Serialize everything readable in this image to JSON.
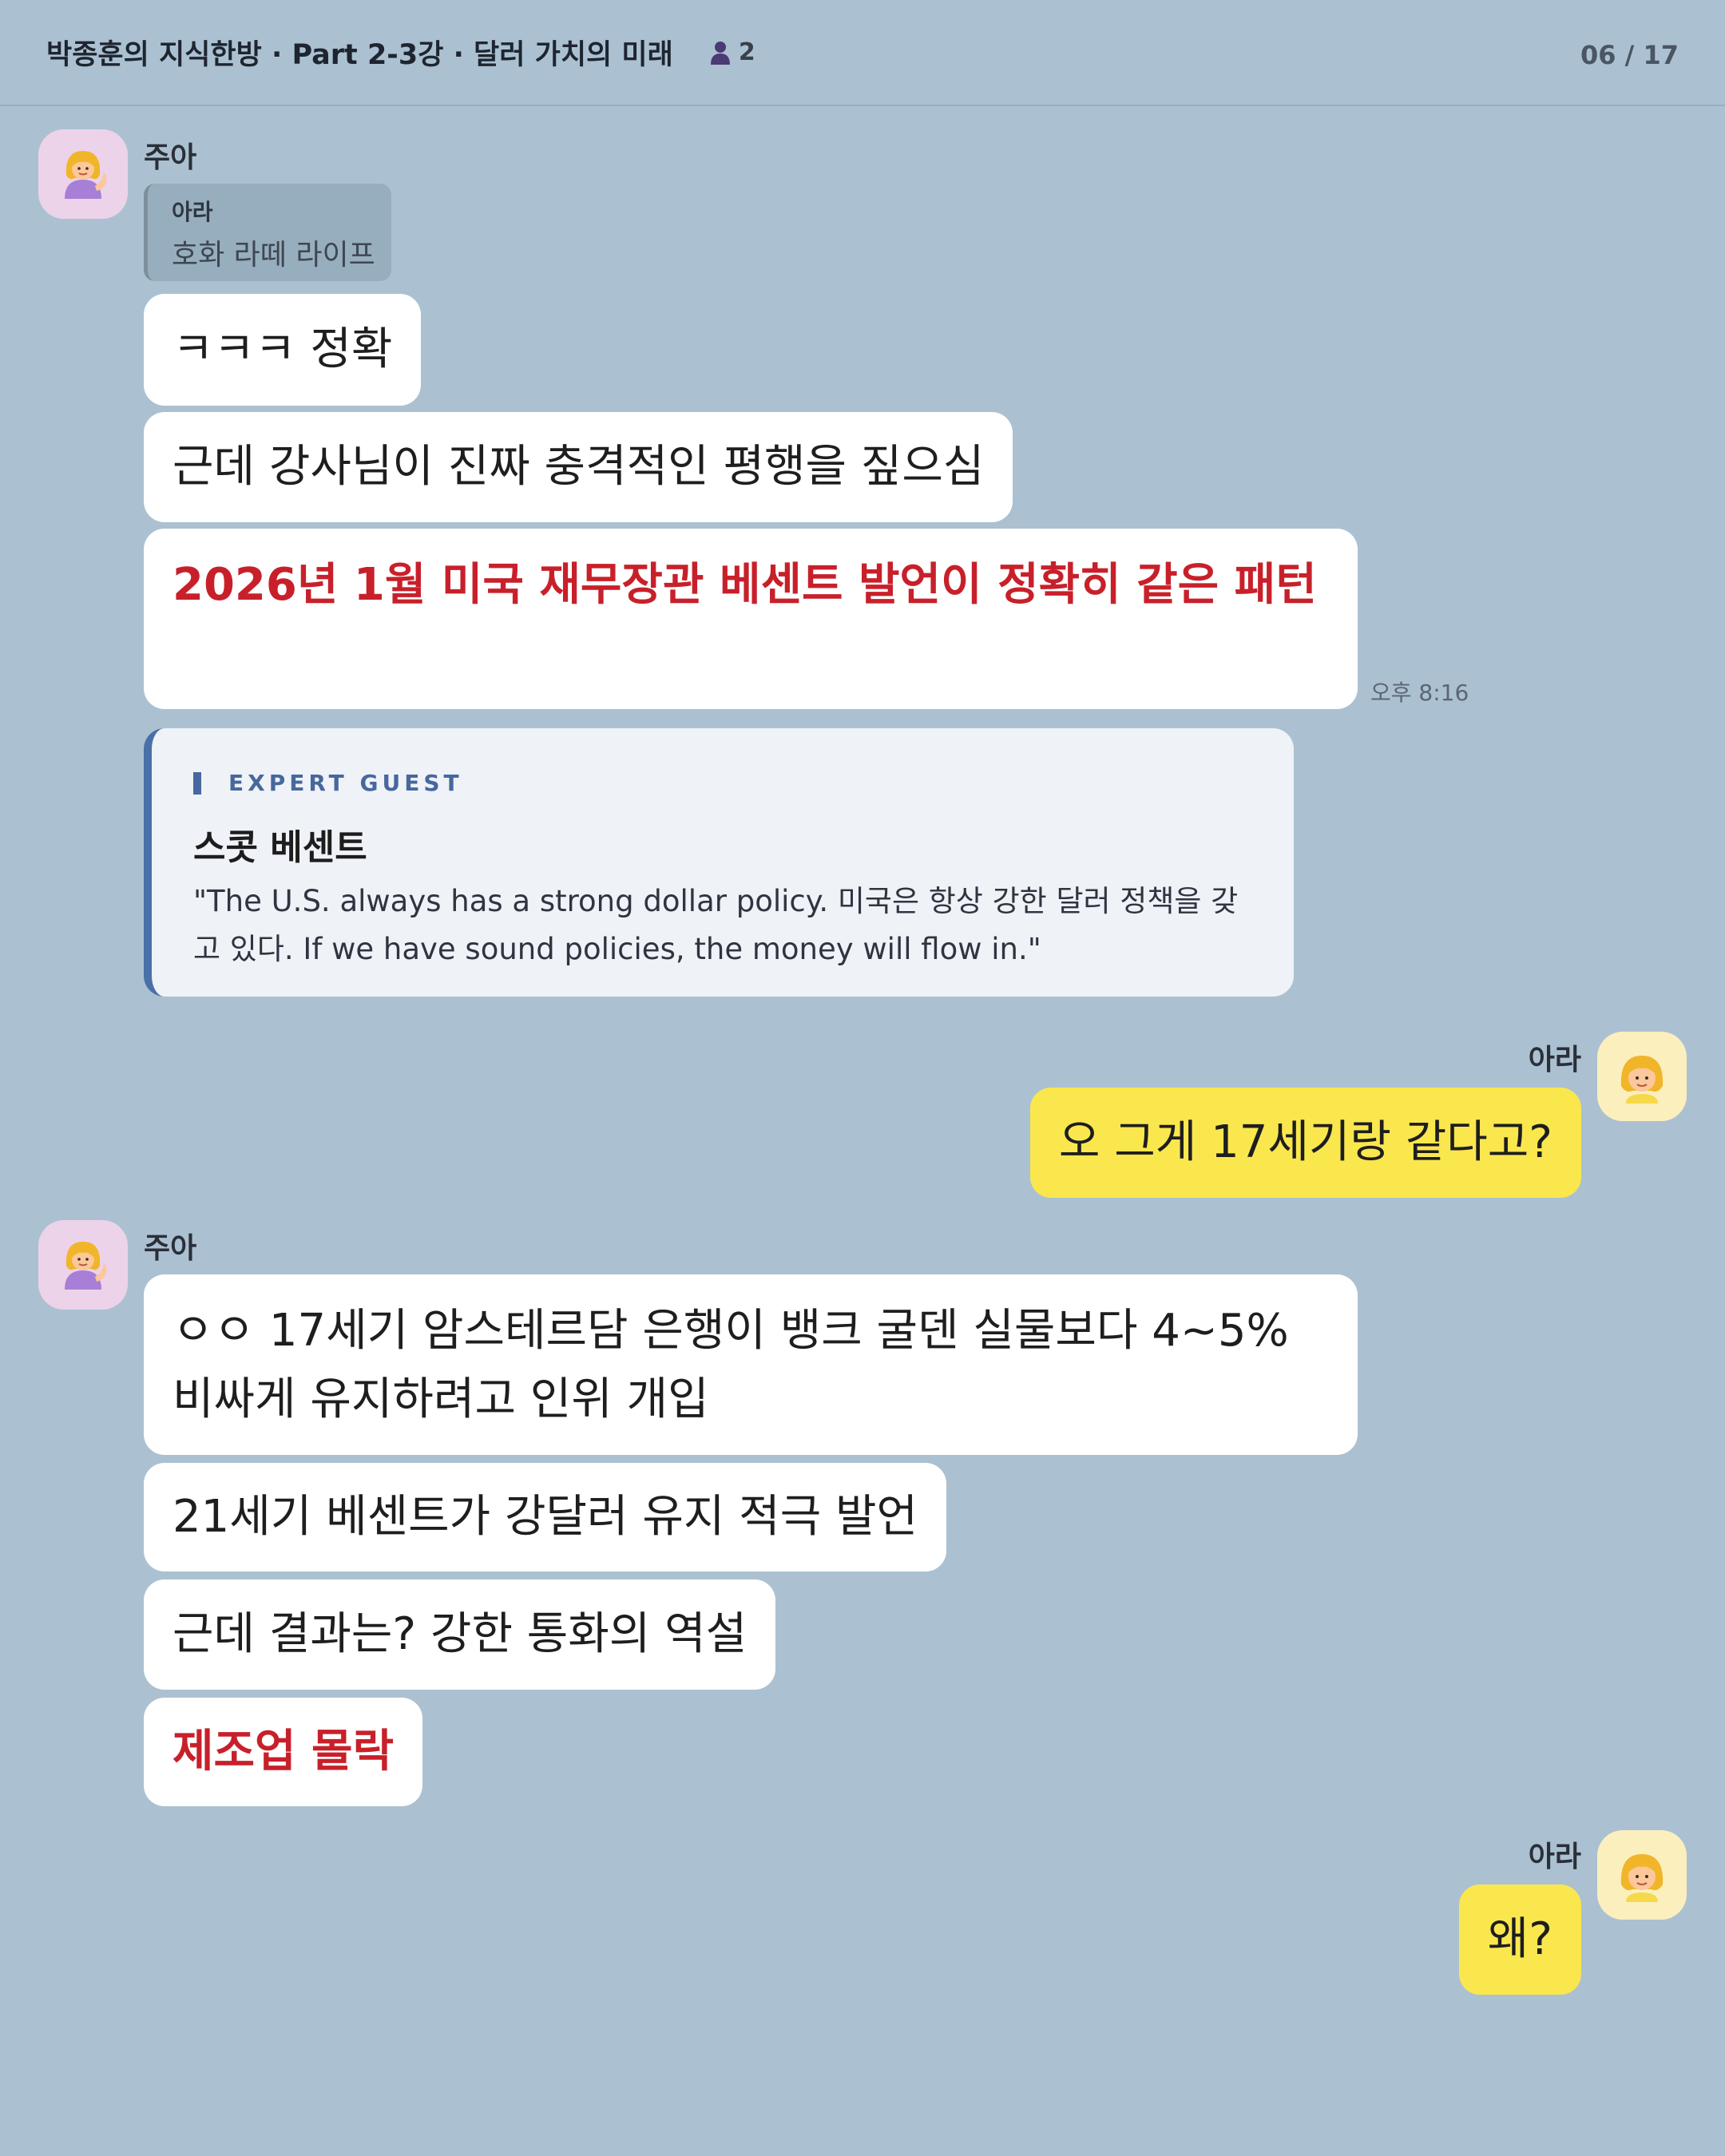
{
  "header": {
    "title": "박종훈의 지식한방 · Part 2-3강 · 달러 가치의 미래",
    "member_count": "2",
    "page_counter": "06 / 17"
  },
  "messages": {
    "m1": {
      "sender": "주아",
      "reply": {
        "name": "아라",
        "text": "호화 라떼 라이프"
      },
      "b1": "ㅋㅋㅋ 정확",
      "b2": "근데 강사님이 진짜 충격적인 평행을 짚으심",
      "b3": "2026년 1월 미국 재무장관 베센트 발언이 정확히 같은 패턴",
      "time": "오후 8:16"
    },
    "expert": {
      "tag": "EXPERT GUEST",
      "name": "스콧 베센트",
      "quote": "\"The U.S. always has a strong dollar policy. 미국은 항상 강한 달러 정책을 갖고 있다. If we have sound policies, the money will flow in.\""
    },
    "m2": {
      "sender": "아라",
      "b1": "오 그게 17세기랑 같다고?"
    },
    "m3": {
      "sender": "주아",
      "b1": "ㅇㅇ 17세기 암스테르담 은행이 뱅크 굴덴 실물보다 4~5% 비싸게 유지하려고 인위 개입",
      "b2": "21세기 베센트가 강달러 유지 적극 발언",
      "b3": "근데 결과는? 강한 통화의 역설",
      "b4": "제조업 몰락"
    },
    "m4": {
      "sender": "아라",
      "b1": "왜?"
    }
  },
  "colors": {
    "background": "#abc1d1",
    "bubble_white": "#ffffff",
    "bubble_yellow": "#fae74e",
    "highlight_red": "#c8202a",
    "expert_accent": "#46689e"
  },
  "icons": {
    "juah_avatar": "woman-tipping-hand-emoji",
    "ara_avatar": "child-emoji",
    "members": "person-icon"
  }
}
